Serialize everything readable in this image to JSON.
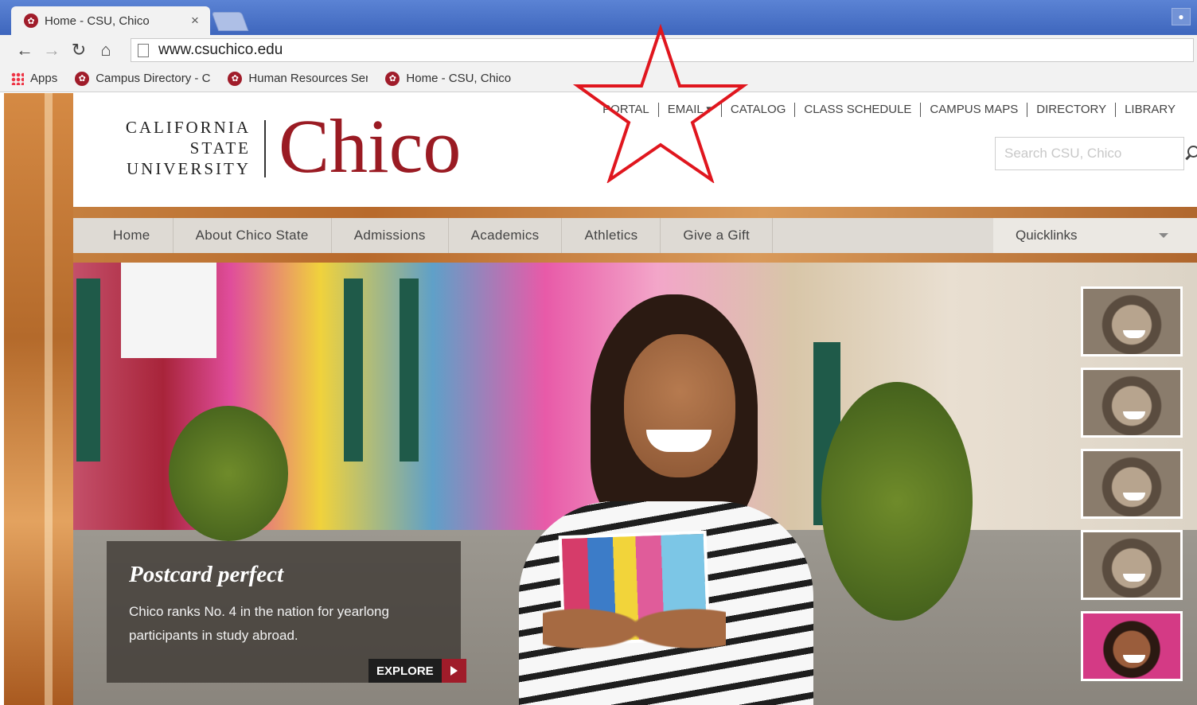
{
  "browser": {
    "tab_title": "Home - CSU, Chico",
    "tab_close": "×",
    "url": "www.csuchico.edu",
    "bookmarks": [
      {
        "label": "Apps",
        "icon": "apps-grid-icon"
      },
      {
        "label": "Campus Directory - C",
        "icon": "csu-chico-favicon"
      },
      {
        "label": "Human Resources Ser",
        "icon": "csu-chico-favicon"
      },
      {
        "label": "Home - CSU, Chico",
        "icon": "csu-chico-favicon"
      }
    ]
  },
  "header": {
    "logo": {
      "line1": "CALIFORNIA",
      "line2": "STATE",
      "line3": "UNIVERSITY",
      "wordmark": "Chico",
      "color": "#9a1b23"
    },
    "utility_nav": [
      "PORTAL",
      "EMAIL ▾",
      "CATALOG",
      "CLASS SCHEDULE",
      "CAMPUS MAPS",
      "DIRECTORY",
      "LIBRARY"
    ],
    "search": {
      "placeholder": "Search CSU, Chico",
      "value": ""
    }
  },
  "main_nav": {
    "items": [
      "Home",
      "About Chico State",
      "Admissions",
      "Academics",
      "Athletics",
      "Give a Gift"
    ],
    "quicklinks_label": "Quicklinks"
  },
  "hero": {
    "caption_title": "Postcard perfect",
    "caption_text": "Chico ranks No. 4 in the nation for yearlong participants in study abroad.",
    "explore_label": "EXPLORE",
    "thumbnails": 5
  },
  "annotation": {
    "shape": "star",
    "color": "#e0161e"
  },
  "colors": {
    "brand_red": "#9a1b23",
    "chrome_blue": "#4a73c9"
  }
}
